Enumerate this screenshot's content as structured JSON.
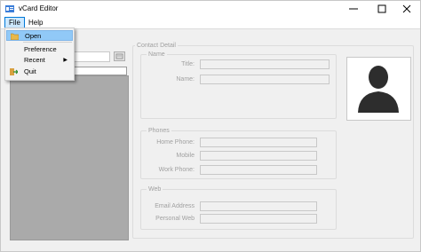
{
  "window": {
    "title": "vCard Editor",
    "controls": [
      "minimize",
      "maximize",
      "close"
    ]
  },
  "menubar": {
    "file_label": "File",
    "help_label": "Help"
  },
  "file_menu": {
    "items": [
      {
        "label": "Open",
        "icon": "open-folder-icon",
        "highlighted": true
      },
      {
        "label": "Preference",
        "icon": null
      },
      {
        "label": "Recent",
        "icon": null,
        "submenu": true
      },
      {
        "label": "Quit",
        "icon": "quit-icon"
      }
    ]
  },
  "contact_detail": {
    "legend": "Contact Detail",
    "name_group": {
      "legend": "Name",
      "title_label": "Title:",
      "name_label": "Name:"
    },
    "phones_group": {
      "legend": "Phones",
      "home_label": "Home Phone:",
      "mobile_label": "Mobile",
      "work_label": "Work Phone:"
    },
    "web_group": {
      "legend": "Web",
      "email_label": "Email Address",
      "personal_web_label": "Personal Web"
    }
  },
  "colors": {
    "menu_highlight": "#91c9f7",
    "list_background": "#aaaaaa",
    "disabled_text": "#a0a0a0"
  }
}
